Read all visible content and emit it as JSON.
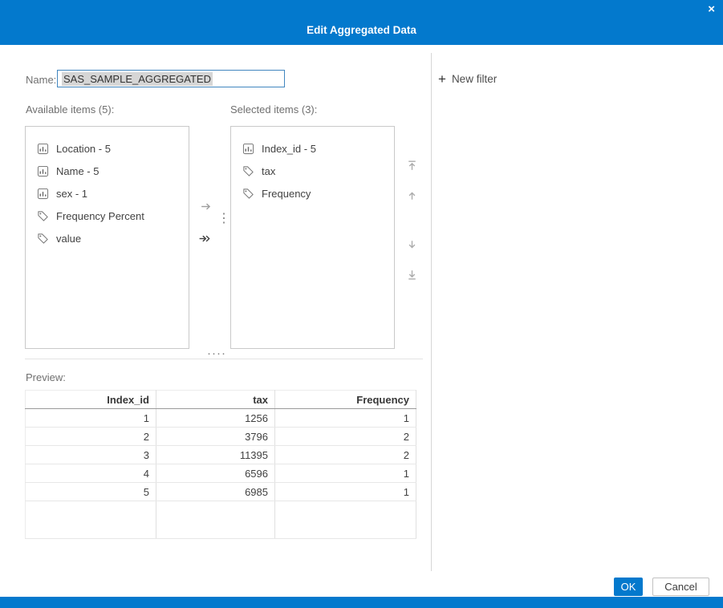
{
  "dialog": {
    "title": "Edit Aggregated Data",
    "close_icon": "×"
  },
  "colors": {
    "accent": "#0379cd"
  },
  "name_field": {
    "label": "Name:",
    "value": "SAS_SAMPLE_AGGREGATED"
  },
  "available": {
    "label": "Available items (5):",
    "items": [
      {
        "label": "Location - 5",
        "icon": "bar-chart"
      },
      {
        "label": "Name - 5",
        "icon": "bar-chart"
      },
      {
        "label": "sex - 1",
        "icon": "bar-chart"
      },
      {
        "label": "Frequency Percent",
        "icon": "tag"
      },
      {
        "label": "value",
        "icon": "tag"
      }
    ]
  },
  "selected": {
    "label": "Selected items (3):",
    "items": [
      {
        "label": "Index_id - 5",
        "icon": "bar-chart"
      },
      {
        "label": "tax",
        "icon": "tag"
      },
      {
        "label": "Frequency",
        "icon": "tag"
      }
    ]
  },
  "splitters": {
    "vertical_dots": "⋮",
    "horizontal_dots": "····"
  },
  "preview": {
    "label": "Preview:",
    "columns": [
      "Index_id",
      "tax",
      "Frequency"
    ],
    "rows": [
      [
        "1",
        "1256",
        "1"
      ],
      [
        "2",
        "3796",
        "2"
      ],
      [
        "3",
        "11395",
        "2"
      ],
      [
        "4",
        "6596",
        "1"
      ],
      [
        "5",
        "6985",
        "1"
      ]
    ]
  },
  "filters": {
    "plus_icon": "+",
    "new_filter_label": "New filter"
  },
  "footer": {
    "ok_label": "OK",
    "cancel_label": "Cancel"
  }
}
